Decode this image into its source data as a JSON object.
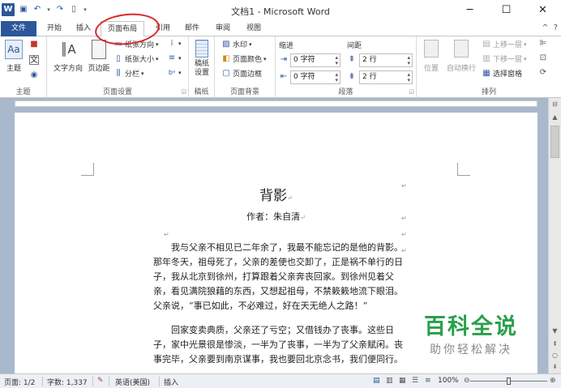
{
  "window": {
    "title": "文档1 - Microsoft Word",
    "minimize_glyph": "─",
    "maximize_glyph": "☐",
    "close_glyph": "✕"
  },
  "qat": {
    "logo": "W",
    "save_glyph": "▣",
    "undo_glyph": "↶",
    "undo_arrow": "▾",
    "redo_glyph": "↷",
    "new_glyph": "▯",
    "customize_glyph": "▾"
  },
  "tabs": [
    {
      "label": "文件"
    },
    {
      "label": "开始"
    },
    {
      "label": "插入"
    },
    {
      "label": "页面布局"
    },
    {
      "label": "引用"
    },
    {
      "label": "邮件"
    },
    {
      "label": "审阅"
    },
    {
      "label": "视图"
    }
  ],
  "tab_right": {
    "help_glyph": "?",
    "expand_glyph": "^"
  },
  "ribbon": {
    "themes": {
      "label": "主题",
      "themes_btn": "主题",
      "colors_glyph": "■",
      "fonts_glyph": "文",
      "effects_glyph": "◉"
    },
    "page_setup": {
      "label": "页面设置",
      "text_direction": "文字方向",
      "margins": "页边距",
      "orientation": "纸张方向",
      "size": "纸张大小",
      "columns": "分栏",
      "breaks_glyph": "⁞",
      "line_numbers_glyph": "≡",
      "hyphenation_glyph": "bᵃ"
    },
    "manuscript": {
      "label": "稿纸",
      "settings": "稿纸设置"
    },
    "page_background": {
      "label": "页面背景",
      "watermark": "水印",
      "page_color": "页面颜色",
      "page_border": "页面边框"
    },
    "paragraph": {
      "label": "段落",
      "indent_header": "缩进",
      "spacing_header": "间距",
      "indent_left": "0 字符",
      "indent_right": "0 字符",
      "spacing_before": "2 行",
      "spacing_after": "2 行"
    },
    "arrange": {
      "label": "排列",
      "position": "位置",
      "wrap_text": "自动换行",
      "bring_forward": "上移一层",
      "send_backward": "下移一层",
      "selection_pane": "选择窗格"
    }
  },
  "document": {
    "title": "背影",
    "author": "作者：朱自清",
    "paragraphs": [
      "我与父亲不相见已二年余了，我最不能忘记的是他的背影。那年冬天，祖母死了，父亲的差使也交卸了，正是祸不单行的日子，我从北京到徐州，打算跟着父亲奔丧回家。到徐州见着父亲，看见满院狼藉的东西，又想起祖母，不禁簌簌地流下眼泪。父亲说，“事已如此，不必难过，好在天无绝人之路！”",
      "回家变卖典质，父亲还了亏空；又借钱办了丧事。这些日子，家中光景很是惨淡，一半为了丧事，一半为了父亲赋闲。丧事完毕，父亲要到南京谋事，我也要回北京念书，我们便同行。"
    ],
    "para_mark": "↵"
  },
  "watermark": {
    "main": "百科全说",
    "sub": "助你轻松解决"
  },
  "status": {
    "page": "页面: 1/2",
    "words": "字数: 1,337",
    "language": "英语(美国)",
    "mode": "插入",
    "zoom": "100%",
    "zoom_fraction": 0.5
  }
}
